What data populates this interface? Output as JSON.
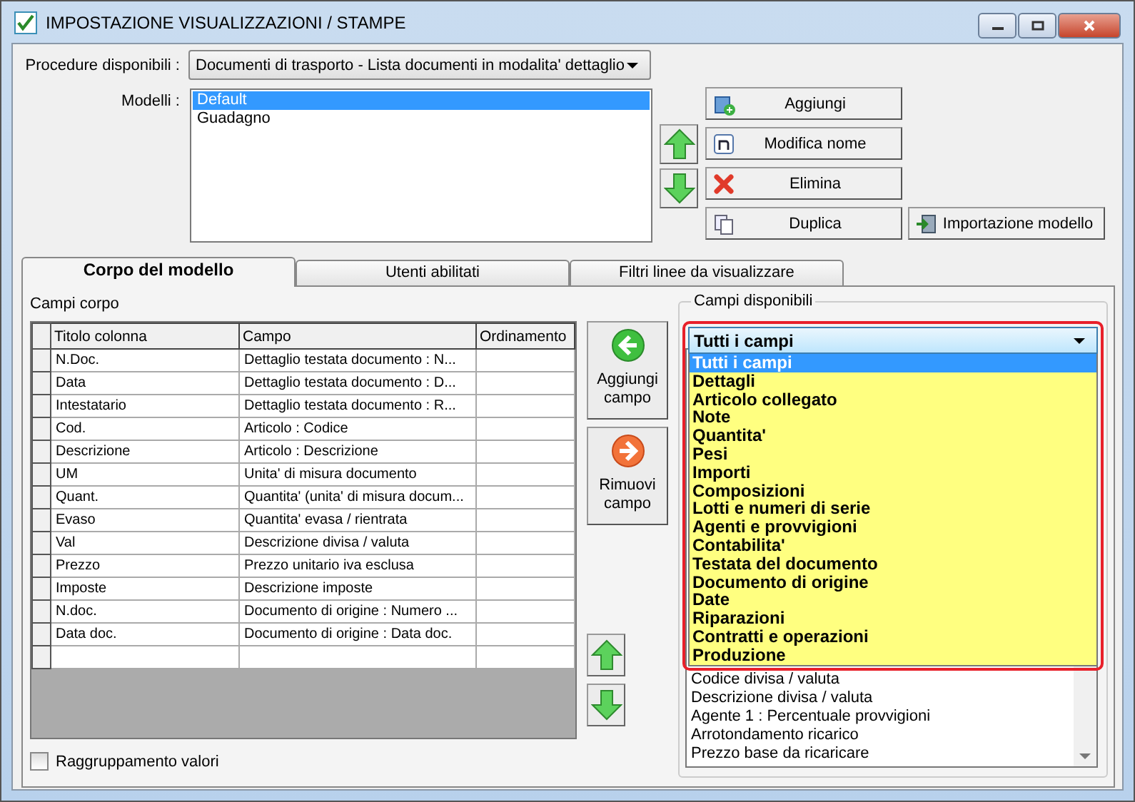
{
  "window": {
    "title": "IMPOSTAZIONE VISUALIZZAZIONI / STAMPE"
  },
  "procedure": {
    "label": "Procedure disponibili :",
    "value": "Documenti di trasporto - Lista documenti in modalita' dettaglio"
  },
  "models": {
    "label": "Modelli :",
    "items": [
      {
        "text": "Default",
        "selected": true
      },
      {
        "text": "Guadagno",
        "selected": false
      }
    ]
  },
  "model_buttons": [
    {
      "label": "Aggiungi",
      "kind": "add"
    },
    {
      "label": "Modifica nome",
      "kind": "rename"
    },
    {
      "label": "Elimina",
      "kind": "delete"
    },
    {
      "label": "Duplica",
      "kind": "copy"
    }
  ],
  "import_button": {
    "label": "Importazione modello"
  },
  "tabs": [
    {
      "label": "Corpo del modello",
      "selected": true
    },
    {
      "label": "Utenti abilitati",
      "selected": false
    },
    {
      "label": "Filtri linee da visualizzare",
      "selected": false
    }
  ],
  "body_fields": {
    "label": "Campi corpo",
    "columns": [
      "Titolo colonna",
      "Campo",
      "Ordinamento"
    ],
    "rows": [
      {
        "title": "N.Doc.",
        "field": "Dettaglio testata documento : N..."
      },
      {
        "title": "Data",
        "field": "Dettaglio testata documento : D..."
      },
      {
        "title": "Intestatario",
        "field": "Dettaglio testata documento : R..."
      },
      {
        "title": "Cod.",
        "field": "Articolo : Codice"
      },
      {
        "title": "Descrizione",
        "field": "Articolo : Descrizione"
      },
      {
        "title": "UM",
        "field": "Unita' di misura documento"
      },
      {
        "title": "Quant.",
        "field": "Quantita' (unita' di misura docum..."
      },
      {
        "title": "Evaso",
        "field": "Quantita' evasa / rientrata"
      },
      {
        "title": "Val",
        "field": "Descrizione divisa / valuta"
      },
      {
        "title": "Prezzo",
        "field": "Prezzo unitario iva esclusa"
      },
      {
        "title": "Imposte",
        "field": "Descrizione imposte"
      },
      {
        "title": "N.doc.",
        "field": "Documento di origine : Numero ..."
      },
      {
        "title": "Data doc.",
        "field": "Documento di origine : Data doc."
      }
    ]
  },
  "field_buttons": [
    {
      "label": "Aggiungi campo",
      "kind": "add"
    },
    {
      "label": "Rimuovi campo",
      "kind": "remove"
    }
  ],
  "available": {
    "label": "Campi disponibili",
    "category": "Tutti i campi",
    "options": [
      {
        "text": "Tutti i campi",
        "selected": true
      },
      {
        "text": "Dettagli",
        "selected": false
      },
      {
        "text": "Articolo collegato",
        "selected": false
      },
      {
        "text": "Note",
        "selected": false
      },
      {
        "text": "Quantita'",
        "selected": false
      },
      {
        "text": "Pesi",
        "selected": false
      },
      {
        "text": "Importi",
        "selected": false
      },
      {
        "text": "Composizioni",
        "selected": false
      },
      {
        "text": "Lotti e numeri di serie",
        "selected": false
      },
      {
        "text": "Agenti e provvigioni",
        "selected": false
      },
      {
        "text": "Contabilita'",
        "selected": false
      },
      {
        "text": "Testata del documento",
        "selected": false
      },
      {
        "text": "Documento di origine",
        "selected": false
      },
      {
        "text": "Date",
        "selected": false
      },
      {
        "text": "Riparazioni",
        "selected": false
      },
      {
        "text": "Contratti e operazioni",
        "selected": false
      },
      {
        "text": "Produzione",
        "selected": false
      }
    ],
    "list": [
      "Codice divisa / valuta",
      "Descrizione divisa / valuta",
      "Agente 1 : Percentuale provvigioni",
      "Arrotondamento ricarico",
      "Prezzo base da ricaricare"
    ]
  },
  "grouping": {
    "label": "Raggruppamento valori",
    "checked": false
  }
}
